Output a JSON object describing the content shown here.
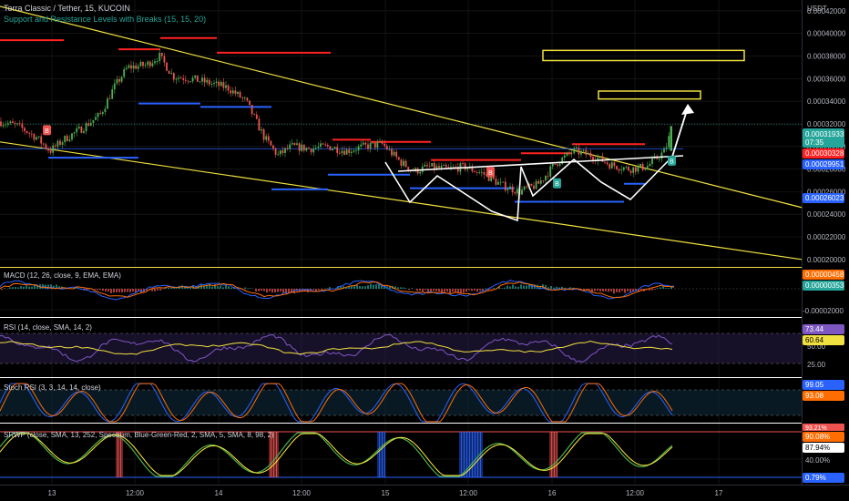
{
  "header": {
    "symbol_line": "Terra Classic / Tether, 15, KUCOIN",
    "indicator_line": "Support and Resistance Levels with Breaks (15, 15, 20)",
    "currency": "USDT"
  },
  "colors": {
    "background": "#000000",
    "grid": "#1f1f1f",
    "up": "#26a69a",
    "down": "#ef5350",
    "bull_wick": "#4caf50",
    "resistance": "#ff2222",
    "support": "#2962ff",
    "channel": "#f0e040",
    "pattern": "#ffffff",
    "axis_text": "#b2b5be",
    "macd_line": "#2962ff",
    "signal_line": "#ff6d00",
    "rsi_line": "#7e57c2",
    "rsi_ma": "#f0e040",
    "stoch_k": "#2962ff",
    "stoch_d": "#ff6d00"
  },
  "chart_data": [
    {
      "type": "candlestick",
      "title": "Terra Classic / Tether, 15, KUCOIN",
      "x_ticks": [
        "13",
        "12:00",
        "14",
        "12:00",
        "15",
        "12:00",
        "16",
        "12:00",
        "17"
      ],
      "y_ticks": [
        "0.00042000",
        "0.00040000",
        "0.00038000",
        "0.00036000",
        "0.00034000",
        "0.00032000",
        "0.00030000",
        "0.00028000",
        "0.00026000",
        "0.00024000",
        "0.00022000",
        "0.00020000"
      ],
      "ylim": [
        0.000195,
        0.000428
      ],
      "close_series": [
        [
          0,
          0.000322
        ],
        [
          20,
          0.000318
        ],
        [
          40,
          0.000308
        ],
        [
          55,
          0.000296
        ],
        [
          70,
          0.000306
        ],
        [
          90,
          0.000316
        ],
        [
          110,
          0.000328
        ],
        [
          125,
          0.000352
        ],
        [
          140,
          0.00037
        ],
        [
          160,
          0.000372
        ],
        [
          175,
          0.00038
        ],
        [
          190,
          0.000362
        ],
        [
          210,
          0.00036
        ],
        [
          230,
          0.000356
        ],
        [
          250,
          0.000352
        ],
        [
          270,
          0.00034
        ],
        [
          290,
          0.000308
        ],
        [
          305,
          0.000292
        ],
        [
          320,
          0.0003
        ],
        [
          340,
          0.000298
        ],
        [
          360,
          0.0003
        ],
        [
          380,
          0.000296
        ],
        [
          400,
          0.0003
        ],
        [
          420,
          0.000302
        ],
        [
          440,
          0.000286
        ],
        [
          455,
          0.000278
        ],
        [
          470,
          0.000282
        ],
        [
          490,
          0.00028
        ],
        [
          510,
          0.000282
        ],
        [
          530,
          0.000276
        ],
        [
          550,
          0.000266
        ],
        [
          570,
          0.00026
        ],
        [
          590,
          0.000266
        ],
        [
          610,
          0.000285
        ],
        [
          630,
          0.000296
        ],
        [
          650,
          0.000292
        ],
        [
          670,
          0.000284
        ],
        [
          690,
          0.00028
        ],
        [
          710,
          0.000282
        ],
        [
          730,
          0.000296
        ],
        [
          738,
          0.000318
        ]
      ],
      "last_price": "0.00031933",
      "countdown": "07:35",
      "resistance_label": "0.00030328",
      "support_label": "0.00029951",
      "low_label": "0.00026023",
      "resistance_levels": [
        {
          "x1": 0,
          "x2": 70,
          "value": 0.000394
        },
        {
          "x1": 130,
          "x2": 176,
          "value": 0.000386
        },
        {
          "x1": 176,
          "x2": 238,
          "value": 0.000396
        },
        {
          "x1": 238,
          "x2": 363,
          "value": 0.000383
        },
        {
          "x1": 365,
          "x2": 407,
          "value": 0.000306
        },
        {
          "x1": 407,
          "x2": 473,
          "value": 0.000304
        },
        {
          "x1": 473,
          "x2": 572,
          "value": 0.000288
        },
        {
          "x1": 572,
          "x2": 628,
          "value": 0.000294
        },
        {
          "x1": 628,
          "x2": 708,
          "value": 0.000302
        }
      ],
      "support_levels": [
        {
          "x1": 53,
          "x2": 152,
          "value": 0.00029
        },
        {
          "x1": 152,
          "x2": 220,
          "value": 0.000338
        },
        {
          "x1": 220,
          "x2": 298,
          "value": 0.000335
        },
        {
          "x1": 298,
          "x2": 360,
          "value": 0.000262
        },
        {
          "x1": 360,
          "x2": 450,
          "value": 0.000275
        },
        {
          "x1": 450,
          "x2": 565,
          "value": 0.000263
        },
        {
          "x1": 565,
          "x2": 685,
          "value": 0.000251
        },
        {
          "x1": 685,
          "x2": 708,
          "value": 0.000267
        }
      ],
      "break_markers": [
        {
          "x": 51,
          "value": 0.000314,
          "label": "B",
          "kind": "bearish"
        },
        {
          "x": 538,
          "value": 0.000277,
          "label": "B",
          "kind": "bearish"
        },
        {
          "x": 611,
          "value": 0.000267,
          "label": "B",
          "kind": "bullish"
        },
        {
          "x": 737,
          "value": 0.000287,
          "label": "B",
          "kind": "bullish"
        }
      ],
      "trendlines": [
        {
          "x1": 0,
          "v1": 0.000424,
          "x2": 880,
          "v2": 0.000246
        },
        {
          "x1": 0,
          "v1": 0.000304,
          "x2": 880,
          "v2": 0.0002
        },
        {
          "x1": 0,
          "v1": 0.000298,
          "x2": 750,
          "v2": 0.000298
        }
      ],
      "target_boxes": [
        {
          "x1": 596,
          "x2": 817,
          "v_top": 0.000385,
          "v_bottom": 0.000376
        },
        {
          "x1": 657,
          "x2": 769,
          "v_top": 0.000349,
          "v_bottom": 0.000342
        }
      ]
    },
    {
      "type": "line",
      "title": "MACD (12, 26, close, 9, EMA, EMA)",
      "y_ticks": [
        "-0.00002000"
      ],
      "ylim": [
        -2.15e-05,
        1.35e-05
      ],
      "value_labels": [
        "0.00000458",
        "0.00000353"
      ]
    },
    {
      "type": "line",
      "title": "RSI (14, close, SMA, 14, 2)",
      "y_ticks": [
        "50.00",
        "25.00"
      ],
      "ylim": [
        10,
        90
      ],
      "value_labels": [
        "73.44",
        "60.64"
      ],
      "bands": [
        70,
        30
      ]
    },
    {
      "type": "line",
      "title": "Stoch RSI (3, 3, 14, 14, close)",
      "ylim": [
        0,
        100
      ],
      "value_labels": [
        "99.05",
        "93.08"
      ],
      "bands": [
        80,
        20
      ]
    },
    {
      "type": "line",
      "title": "SRWP (close, SMA, 13, 252, Spectrum, Blue-Green-Red, 2, SMA, 5, SMA, 8, 98, 2)",
      "y_ticks": [
        "40.00%"
      ],
      "ylim": [
        0,
        100
      ],
      "value_labels": [
        "93.21%",
        "90.08%",
        "87.94%",
        "0.79%"
      ]
    }
  ]
}
